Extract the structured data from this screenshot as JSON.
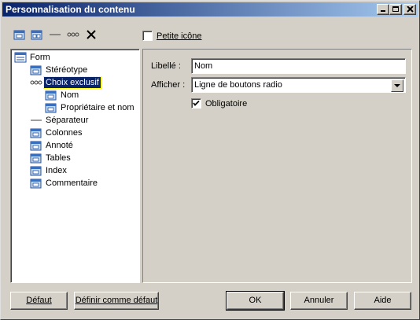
{
  "window": {
    "title": "Personnalisation du contenu"
  },
  "toolbar": {
    "icons": [
      "add-item-icon",
      "add-group-icon",
      "separator-icon",
      "exclusive-choice-icon",
      "delete-icon"
    ],
    "small_icon_checkbox": {
      "label": "Petite icône",
      "checked": false
    }
  },
  "tree": {
    "items": [
      {
        "label": "Form",
        "icon": "form-icon",
        "level": 0,
        "selected": false
      },
      {
        "label": "Stéréotype",
        "icon": "item-icon",
        "level": 1,
        "selected": false
      },
      {
        "label": "Choix exclusif",
        "icon": "exclusive-choice-icon",
        "level": 1,
        "selected": true
      },
      {
        "label": "Nom",
        "icon": "item-icon",
        "level": 2,
        "selected": false
      },
      {
        "label": "Propriétaire et nom",
        "icon": "item-icon",
        "level": 2,
        "selected": false
      },
      {
        "label": "Séparateur",
        "icon": "separator-icon",
        "level": 1,
        "selected": false
      },
      {
        "label": "Colonnes",
        "icon": "item-icon",
        "level": 1,
        "selected": false
      },
      {
        "label": "Annoté",
        "icon": "item-icon",
        "level": 1,
        "selected": false
      },
      {
        "label": "Tables",
        "icon": "item-icon",
        "level": 1,
        "selected": false
      },
      {
        "label": "Index",
        "icon": "item-icon",
        "level": 1,
        "selected": false
      },
      {
        "label": "Commentaire",
        "icon": "item-icon",
        "level": 1,
        "selected": false
      }
    ]
  },
  "properties": {
    "libelle_label": "Libellé :",
    "libelle_value": "Nom",
    "afficher_label": "Afficher :",
    "afficher_value": "Ligne de boutons radio",
    "obligatoire_label": "Obligatoire",
    "obligatoire_checked": true
  },
  "buttons": {
    "defaut": "Défaut",
    "definir_defaut": "Définir comme défaut",
    "ok": "OK",
    "annuler": "Annuler",
    "aide": "Aide"
  },
  "colors": {
    "titlebar_start": "#0a246a",
    "titlebar_end": "#a6caf0",
    "selection": "#0a246a",
    "face": "#d4d0c8"
  }
}
